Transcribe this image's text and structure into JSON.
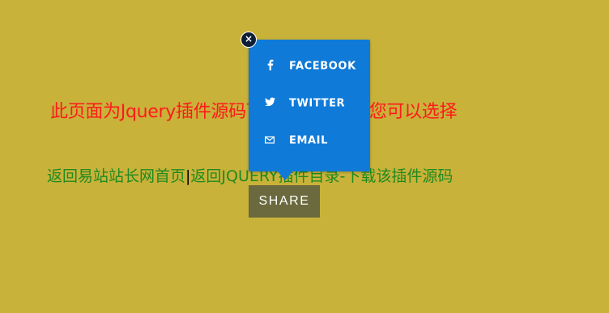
{
  "notice": {
    "text": "此页面为Jquery插件源码下载演示页面，您可以选择"
  },
  "links": {
    "home": "返回易站站长网首页",
    "separator": "|",
    "category": "返回JQUERY插件目录",
    "dash": "-",
    "download": "下载该插件源码"
  },
  "share": {
    "button_label": "SHARE",
    "close_glyph": "×",
    "items": [
      {
        "icon": "facebook-icon",
        "glyph": "f",
        "label": "FACEBOOK"
      },
      {
        "icon": "twitter-icon",
        "glyph": "🐦",
        "label": "TWITTER"
      },
      {
        "icon": "mail-icon",
        "glyph": "✉",
        "label": "EMAIL"
      }
    ]
  },
  "colors": {
    "background": "#c9b23a",
    "popup": "#0f7ad8",
    "button": "#6b6a3e",
    "notice": "#ff1a1a",
    "link": "#1f8a1f",
    "close": "#0e1e36"
  }
}
